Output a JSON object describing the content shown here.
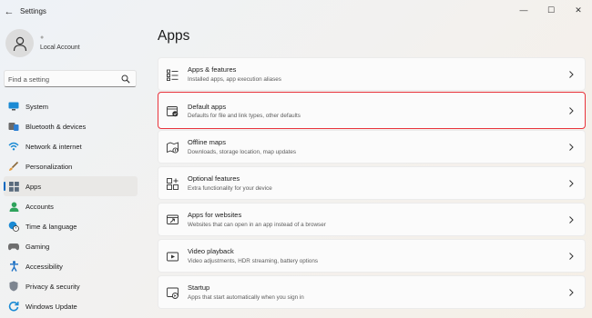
{
  "window": {
    "title": "Settings",
    "back_glyph": "←",
    "minimize_glyph": "—",
    "maximize_glyph": "☐",
    "close_glyph": "✕"
  },
  "profile": {
    "name": "Local Account",
    "extra": "●"
  },
  "search": {
    "placeholder": "Find a setting"
  },
  "sidebar": {
    "items": [
      {
        "label": "System",
        "icon": "monitor-icon",
        "selected": false
      },
      {
        "label": "Bluetooth & devices",
        "icon": "bluetooth-icon",
        "selected": false
      },
      {
        "label": "Network & internet",
        "icon": "wifi-icon",
        "selected": false
      },
      {
        "label": "Personalization",
        "icon": "brush-icon",
        "selected": false
      },
      {
        "label": "Apps",
        "icon": "apps-icon",
        "selected": true
      },
      {
        "label": "Accounts",
        "icon": "person-icon",
        "selected": false
      },
      {
        "label": "Time & language",
        "icon": "globe-clock-icon",
        "selected": false
      },
      {
        "label": "Gaming",
        "icon": "gamepad-icon",
        "selected": false
      },
      {
        "label": "Accessibility",
        "icon": "accessibility-icon",
        "selected": false
      },
      {
        "label": "Privacy & security",
        "icon": "shield-icon",
        "selected": false
      },
      {
        "label": "Windows Update",
        "icon": "update-icon",
        "selected": false
      }
    ]
  },
  "main": {
    "title": "Apps",
    "cards": [
      {
        "title": "Apps & features",
        "desc": "Installed apps, app execution aliases",
        "icon": "apps-list-icon",
        "highlighted": false
      },
      {
        "title": "Default apps",
        "desc": "Defaults for file and link types, other defaults",
        "icon": "default-apps-icon",
        "highlighted": true
      },
      {
        "title": "Offline maps",
        "desc": "Downloads, storage location, map updates",
        "icon": "offline-map-icon",
        "highlighted": false
      },
      {
        "title": "Optional features",
        "desc": "Extra functionality for your device",
        "icon": "optional-features-icon",
        "highlighted": false
      },
      {
        "title": "Apps for websites",
        "desc": "Websites that can open in an app instead of a browser",
        "icon": "apps-for-websites-icon",
        "highlighted": false
      },
      {
        "title": "Video playback",
        "desc": "Video adjustments, HDR streaming, battery options",
        "icon": "video-playback-icon",
        "highlighted": false
      },
      {
        "title": "Startup",
        "desc": "Apps that start automatically when you sign in",
        "icon": "startup-icon",
        "highlighted": false
      }
    ]
  },
  "colors": {
    "accent": "#0067c0",
    "highlight_border": "#e8333b"
  }
}
